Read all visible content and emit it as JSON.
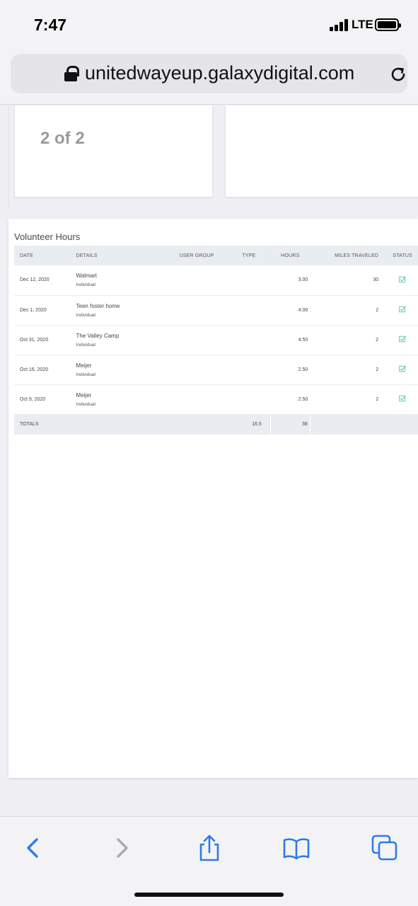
{
  "status_bar": {
    "time": "7:47",
    "network": "LTE"
  },
  "browser": {
    "url": "unitedwayeup.galaxydigital.com"
  },
  "page": {
    "pagination": "2 of 2",
    "volunteer_hours": {
      "title": "Volunteer Hours",
      "columns": [
        "DATE",
        "DETAILS",
        "USER GROUP",
        "TYPE",
        "HOURS",
        "MILES TRAVELED",
        "STATUS"
      ],
      "rows": [
        {
          "date": "Dec 12, 2020",
          "details": "Walmart",
          "sub": "Individual",
          "user_group": "",
          "type": "",
          "hours": "3.00",
          "miles": "30",
          "status": "approved"
        },
        {
          "date": "Dec 1, 2020",
          "details": "Teen foster home",
          "sub": "Individual",
          "user_group": "",
          "type": "",
          "hours": "4.00",
          "miles": "2",
          "status": "approved"
        },
        {
          "date": "Oct 31, 2020",
          "details": "The Valley Camp",
          "sub": "Individual",
          "user_group": "",
          "type": "",
          "hours": "4.50",
          "miles": "2",
          "status": "approved"
        },
        {
          "date": "Oct 16, 2020",
          "details": "Meijer",
          "sub": "Individual",
          "user_group": "",
          "type": "",
          "hours": "2.50",
          "miles": "2",
          "status": "approved"
        },
        {
          "date": "Oct 9, 2020",
          "details": "Meijer",
          "sub": "Individual",
          "user_group": "",
          "type": "",
          "hours": "2.50",
          "miles": "2",
          "status": "approved"
        }
      ],
      "totals": {
        "label": "TOTALS",
        "hours": "16.5",
        "miles": "38"
      }
    }
  },
  "toolbar": {
    "icons": [
      "back-icon",
      "forward-icon",
      "share-icon",
      "bookmarks-icon",
      "tabs-icon"
    ]
  },
  "colors": {
    "accent": "#2f7be5",
    "check": "#52c49a",
    "table_header": "#e9edf2"
  }
}
